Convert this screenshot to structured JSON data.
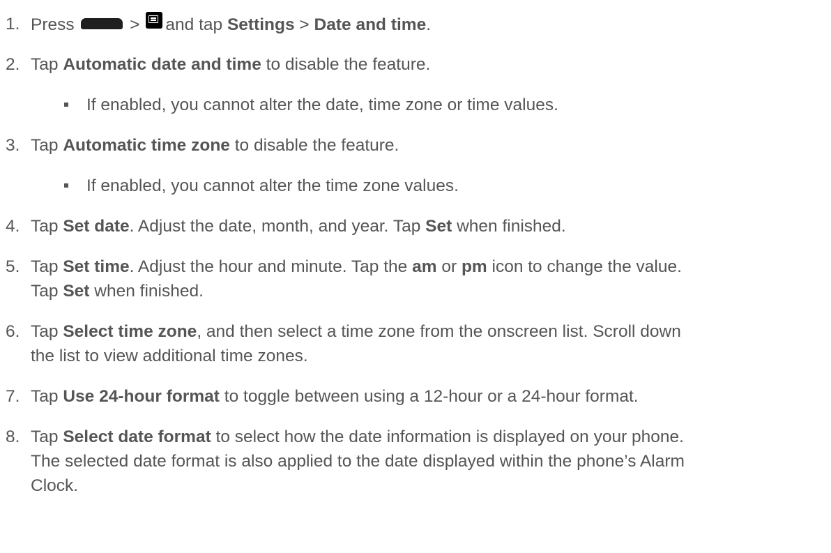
{
  "steps": [
    {
      "num": "1.",
      "t1": "Press",
      "t2": ">",
      "t3": "and tap",
      "b1": "Settings",
      "t4": ">",
      "b2": "Date and time",
      "t5": ".",
      "icons": [
        "home-key-icon",
        "menu-key-icon"
      ]
    },
    {
      "num": "2.",
      "t1": "Tap",
      "b1": "Automatic date and time",
      "t2": "to disable the feature.",
      "bullet": "If enabled, you cannot alter the date, time zone or time values."
    },
    {
      "num": "3.",
      "t1": "Tap",
      "b1": "Automatic time zone",
      "t2": "to disable the feature.",
      "bullet": "If enabled, you cannot alter the time zone values."
    },
    {
      "num": "4.",
      "t1": "Tap",
      "b1": "Set date",
      "t2": ". Adjust the date, month, and year. Tap",
      "b2": "Set",
      "t3": "when finished."
    },
    {
      "num": "5.",
      "t1": "Tap",
      "b1": "Set time",
      "t2": ". Adjust the hour and minute. Tap the",
      "b2": "am",
      "t3": "or",
      "b3": "pm",
      "t4": "icon to change the value.",
      "l2t1": "Tap",
      "l2b1": "Set",
      "l2t2": "when finished."
    },
    {
      "num": "6.",
      "t1": "Tap",
      "b1": "Select time zone",
      "t2": ", and then select a time zone from the onscreen list. Scroll down",
      "line2": "the list to view additional time zones."
    },
    {
      "num": "7.",
      "t1": "Tap",
      "b1": "Use 24-hour format",
      "t2": "to toggle between using a 12-hour or a 24-hour format."
    },
    {
      "num": "8.",
      "t1": "Tap",
      "b1": "Select date format",
      "t2": "to select how the date information is displayed on your phone.",
      "line2": "The selected date format is also applied to the date displayed within the phone’s Alarm",
      "line3": "Clock."
    }
  ]
}
